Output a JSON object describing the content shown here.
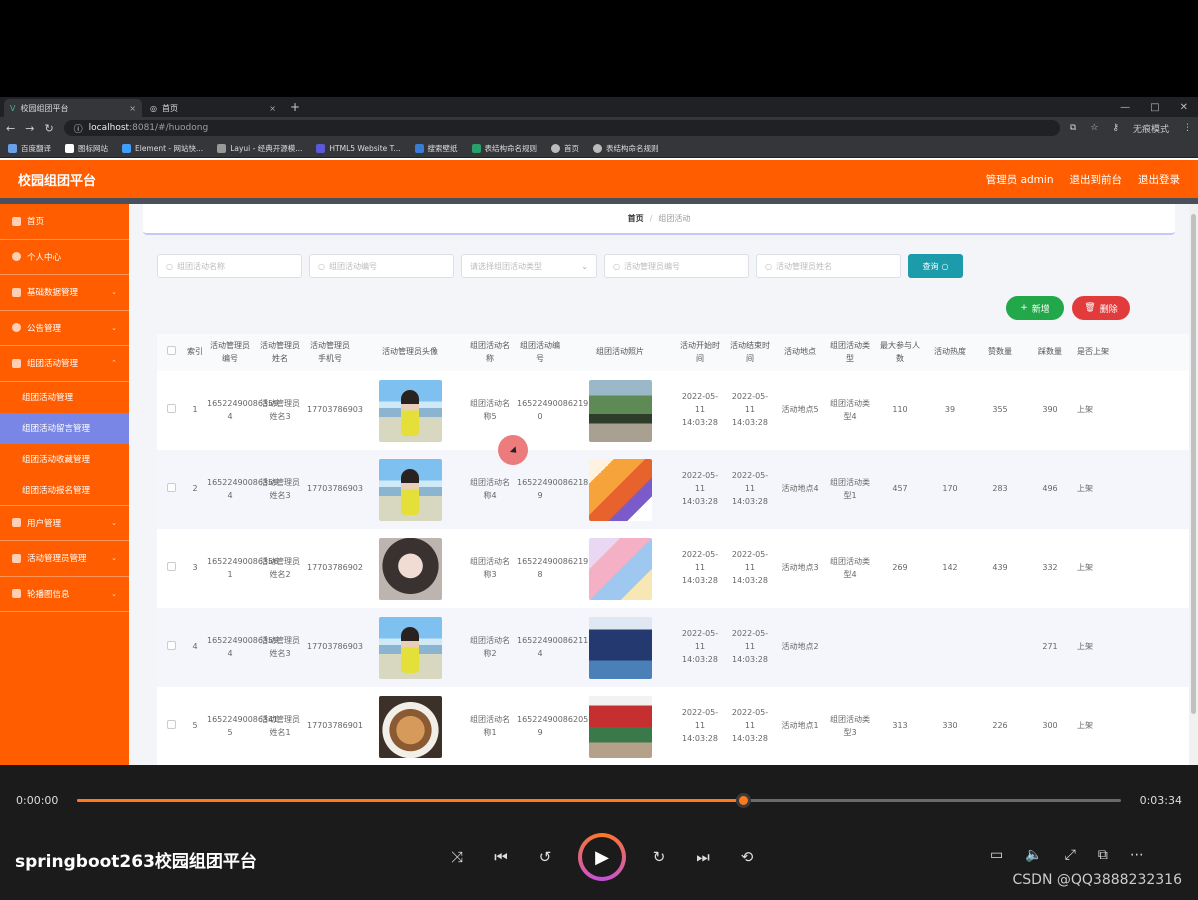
{
  "browser": {
    "tabs": [
      {
        "label": "校园组团平台"
      },
      {
        "label": "首页"
      }
    ],
    "url_host": "localhost",
    "url_path": ":8081/#/huodong",
    "profile": "无痕模式",
    "bookmarks": [
      "百度翻译",
      "图标网站",
      "Element - 网站快...",
      "Layui - 经典开源模...",
      "HTML5 Website T...",
      "搜索壁纸",
      "表结构命名规则",
      "首页",
      "表结构命名规则"
    ]
  },
  "app": {
    "brand": "校园组团平台",
    "admin_label": "管理员 admin",
    "back_label": "退出到前台",
    "logout_label": "退出登录"
  },
  "sidebar": {
    "items": [
      {
        "label": "首页"
      },
      {
        "label": "个人中心"
      },
      {
        "label": "基础数据管理"
      },
      {
        "label": "公告管理"
      },
      {
        "label": "组团活动管理"
      }
    ],
    "sub_items": [
      {
        "label": "组团活动管理"
      },
      {
        "label": "组团活动留言管理"
      },
      {
        "label": "组团活动收藏管理"
      },
      {
        "label": "组团活动报名管理"
      }
    ],
    "items_after": [
      {
        "label": "用户管理"
      },
      {
        "label": "活动管理员管理"
      },
      {
        "label": "轮播图信息"
      }
    ]
  },
  "breadcrumb": {
    "home": "首页",
    "sep": "/",
    "current": "组团活动"
  },
  "filters": {
    "name_ph": "组团活动名称",
    "code_ph": "组团活动编号",
    "type_ph": "请选择组团活动类型",
    "mgr_code_ph": "活动管理员编号",
    "mgr_name_ph": "活动管理员姓名",
    "search_label": "查询"
  },
  "actions": {
    "add_label": "新增",
    "delete_label": "删除"
  },
  "table": {
    "headers": [
      "",
      "索引",
      "活动管理员编号",
      "活动管理员姓名",
      "活动管理员手机号",
      "活动管理员头像",
      "组团活动名称",
      "组团活动编号",
      "组团活动照片",
      "活动开始时间",
      "活动结束时间",
      "活动地点",
      "组团活动类型",
      "最大参与人数",
      "活动热度",
      "赞数量",
      "踩数量",
      "是否上架"
    ],
    "rows": [
      {
        "idx": "1",
        "mgr_code": "16522490086359 4",
        "mgr_name": "活动管理员姓名3",
        "phone": "17703786903",
        "name": "组团活动名称5",
        "code": "16522490086219 0",
        "start": "2022-05-11 14:03:28",
        "end": "2022-05-11 14:03:28",
        "place": "活动地点5",
        "type": "组团活动类型4",
        "max": "110",
        "hot": "39",
        "up": "355",
        "down": "390",
        "shelf": "上架"
      },
      {
        "idx": "2",
        "mgr_code": "16522490086359 4",
        "mgr_name": "活动管理员姓名3",
        "phone": "17703786903",
        "name": "组团活动名称4",
        "code": "16522490086218 9",
        "start": "2022-05-11 14:03:28",
        "end": "2022-05-11 14:03:28",
        "place": "活动地点4",
        "type": "组团活动类型1",
        "max": "457",
        "hot": "170",
        "up": "283",
        "down": "496",
        "shelf": "上架"
      },
      {
        "idx": "3",
        "mgr_code": "16522490086356 1",
        "mgr_name": "活动管理员姓名2",
        "phone": "17703786902",
        "name": "组团活动名称3",
        "code": "16522490086219 8",
        "start": "2022-05-11 14:03:28",
        "end": "2022-05-11 14:03:28",
        "place": "活动地点3",
        "type": "组团活动类型4",
        "max": "269",
        "hot": "142",
        "up": "439",
        "down": "332",
        "shelf": "上架"
      },
      {
        "idx": "4",
        "mgr_code": "16522490086359 4",
        "mgr_name": "活动管理员姓名3",
        "phone": "17703786903",
        "name": "组团活动名称2",
        "code": "16522490086211 4",
        "start": "2022-05-11 14:03:28",
        "end": "2022-05-11 14:03:28",
        "place": "活动地点2",
        "type": "",
        "max": "",
        "hot": "",
        "up": "",
        "down": "271",
        "shelf": "上架"
      },
      {
        "idx": "5",
        "mgr_code": "16522490086341 5",
        "mgr_name": "活动管理员姓名1",
        "phone": "17703786901",
        "name": "组团活动名称1",
        "code": "16522490086205 9",
        "start": "2022-05-11 14:03:28",
        "end": "2022-05-11 14:03:28",
        "place": "活动地点1",
        "type": "组团活动类型3",
        "max": "313",
        "hot": "330",
        "up": "226",
        "down": "300",
        "shelf": "上架"
      }
    ]
  },
  "player": {
    "time_current": "0:00:00",
    "time_total": "0:03:34",
    "progress": 0.638,
    "title": "springboot263校园组团平台",
    "watermark": "CSDN @QQ3888232316"
  },
  "colors": {
    "brand": "#ff5d00",
    "accent": "#ff7a1f",
    "sub_active": "#7986e6",
    "search": "#1c9bab"
  }
}
